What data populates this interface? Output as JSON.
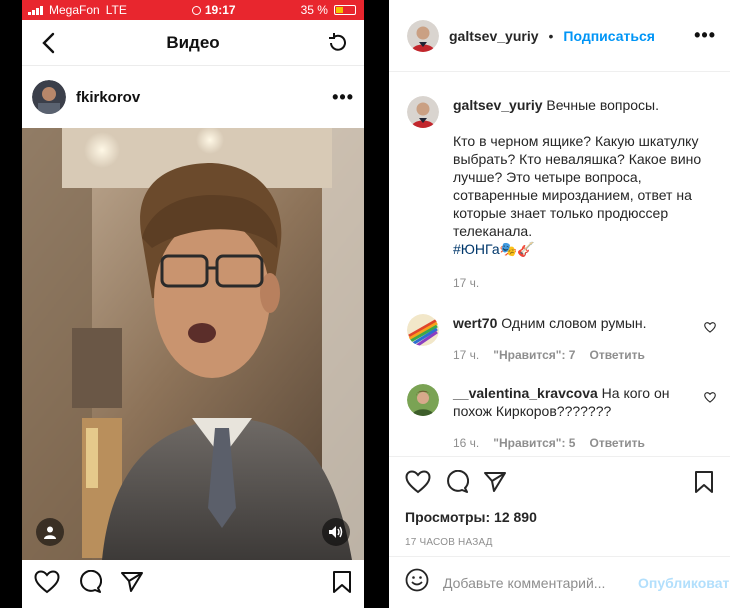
{
  "phone": {
    "status": {
      "carrier": "MegaFon",
      "network": "LTE",
      "time": "19:17",
      "battery": "35 %"
    },
    "nav": {
      "title": "Видео"
    },
    "post": {
      "username": "fkirkorov",
      "more": "•••"
    }
  },
  "panel": {
    "header": {
      "username": "galtsev_yuriy",
      "separator": "•",
      "follow": "Подписаться",
      "more": "•••"
    },
    "caption": {
      "username": "galtsev_yuriy",
      "first_line": "Вечные вопросы.",
      "body": "Кто в черном ящике? Какую шкатулку выбрать? Кто неваляшка? Какое вино лучше? Это четыре вопроса, сотваренные мирозданием, ответ на которые знает только продюссер телеканала.",
      "hashtag": "#ЮНГа",
      "emoji": "🎭🎸",
      "time": "17 ч."
    },
    "comments": [
      {
        "username": "wert70",
        "text": "Одним словом румын.",
        "time": "17 ч.",
        "likes": "\"Нравится\": 7",
        "reply": "Ответить"
      },
      {
        "username": "__valentina_kravcova",
        "text": "На кого он похож Киркоров???????",
        "time": "16 ч.",
        "likes": "\"Нравится\": 5",
        "reply": "Ответить"
      }
    ],
    "views": "Просмотры: 12 890",
    "posted_ago": "17 ЧАСОВ НАЗАД",
    "add_comment": {
      "placeholder": "Добавьте комментарий...",
      "publish": "Опубликовать"
    }
  },
  "colors": {
    "status_bar": "#e8262e",
    "link_blue": "#0095f6",
    "publish_disabled": "#b2dffc",
    "muted": "#8e8e8e"
  }
}
